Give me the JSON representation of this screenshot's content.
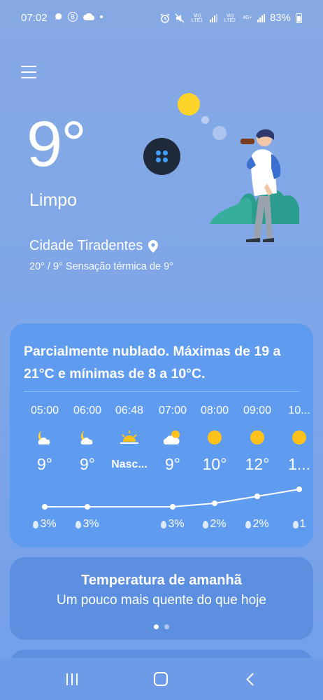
{
  "status_bar": {
    "time": "07:02",
    "battery": "83%",
    "sim1_label": "Vo) LTE1",
    "sim2_label": "Vo) LTE2",
    "network": "4G+"
  },
  "current": {
    "temperature": "9°",
    "condition": "Limpo",
    "city": "Cidade Tiradentes",
    "minmax_feels": "20° / 9° Sensação térmica de 9°"
  },
  "forecast": {
    "summary": "Parcialmente nublado. Máximas de 19 a 21°C e mínimas de 8 a 10°C.",
    "hours": [
      {
        "time": "05:00",
        "icon": "moon-partly-cloudy-icon",
        "temp": "9°",
        "precip": "3%"
      },
      {
        "time": "06:00",
        "icon": "moon-partly-cloudy-icon",
        "temp": "9°",
        "precip": "3%"
      },
      {
        "time": "06:48",
        "icon": "sunrise-icon",
        "temp": "Nasc...",
        "precip": ""
      },
      {
        "time": "07:00",
        "icon": "sun-cloud-icon",
        "temp": "9°",
        "precip": "3%"
      },
      {
        "time": "08:00",
        "icon": "sun-icon",
        "temp": "10°",
        "precip": "2%"
      },
      {
        "time": "09:00",
        "icon": "sun-icon",
        "temp": "12°",
        "precip": "2%"
      },
      {
        "time": "10...",
        "icon": "sun-icon",
        "temp": "1...",
        "precip": "1"
      }
    ],
    "temp_values": [
      9,
      9,
      null,
      9,
      10,
      12,
      14
    ]
  },
  "tomorrow": {
    "title": "Temperatura de amanhã",
    "text": "Um pouco mais quente do que hoje",
    "page_count": 2,
    "active_page": 1
  }
}
